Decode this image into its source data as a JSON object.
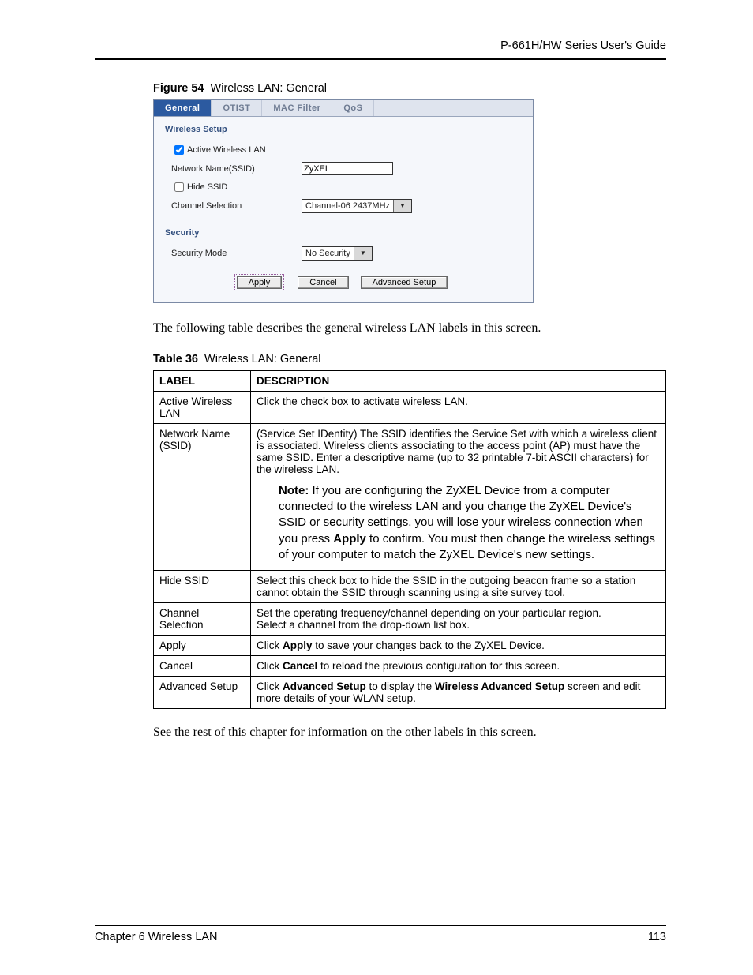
{
  "header": {
    "running": "P-661H/HW Series User's Guide"
  },
  "figure": {
    "label": "Figure 54",
    "title": "Wireless LAN: General"
  },
  "ui": {
    "tabs": {
      "general": "General",
      "otist": "OTIST",
      "macfilter": "MAC Filter",
      "qos": "QoS"
    },
    "section_wireless": "Wireless Setup",
    "active_lbl": "Active Wireless LAN",
    "ssid_lbl": "Network Name(SSID)",
    "ssid_val": "ZyXEL",
    "hide_lbl": "Hide SSID",
    "channel_lbl": "Channel Selection",
    "channel_val": "Channel-06 2437MHz",
    "section_security": "Security",
    "secmode_lbl": "Security Mode",
    "secmode_val": "No Security",
    "btn_apply": "Apply",
    "btn_cancel": "Cancel",
    "btn_adv": "Advanced Setup"
  },
  "para1": "The following table describes the general wireless LAN labels in this screen.",
  "table_caption": {
    "label": "Table 36",
    "title": "Wireless LAN: General"
  },
  "thead": {
    "c1": "LABEL",
    "c2": "DESCRIPTION"
  },
  "rows": {
    "r1": {
      "label": "Active Wireless LAN",
      "desc": "Click the check box to activate wireless LAN."
    },
    "r2": {
      "label": "Network Name (SSID)",
      "desc": "(Service Set IDentity) The SSID identifies the Service Set with which a wireless client is associated. Wireless clients associating to the access point (AP) must have the same SSID. Enter a descriptive name (up to 32 printable 7-bit ASCII characters) for the wireless LAN.",
      "note_prefix": "Note:",
      "note_before_apply": " If you are configuring the ZyXEL Device from a computer connected to the wireless LAN and you change the ZyXEL Device's SSID or security settings, you will lose your wireless connection when you press ",
      "note_apply": "Apply",
      "note_after_apply": " to confirm. You must then change the wireless settings of your computer to match the ZyXEL Device's new settings."
    },
    "r3": {
      "label": "Hide SSID",
      "desc": "Select this check box to hide the SSID in the outgoing beacon frame so a station cannot obtain the SSID through scanning using a site survey tool."
    },
    "r4": {
      "label": "Channel Selection",
      "line1": "Set the operating frequency/channel depending on your particular region.",
      "line2": "Select a channel from the drop-down list box."
    },
    "r5": {
      "label": "Apply",
      "pre": "Click ",
      "b": "Apply",
      "post": " to save your changes back to the ZyXEL Device."
    },
    "r6": {
      "label": "Cancel",
      "pre": "Click ",
      "b": "Cancel",
      "post": " to reload the previous configuration for this screen."
    },
    "r7": {
      "label": "Advanced Setup",
      "pre": "Click ",
      "b1": "Advanced Setup",
      "mid": " to display the ",
      "b2": "Wireless Advanced Setup",
      "post": " screen and edit more details of your WLAN setup."
    }
  },
  "para2": "See the rest of this chapter for information on the other labels in this screen.",
  "footer": {
    "chapter": "Chapter 6 Wireless LAN",
    "page": "113"
  }
}
